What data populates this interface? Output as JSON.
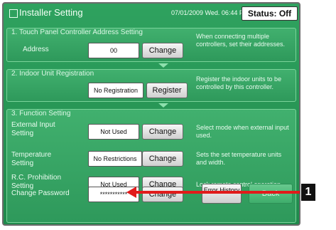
{
  "header": {
    "title": "Installer Setting",
    "datetime": "07/01/2009 Wed. 06:44 PM",
    "status": "Status: Off"
  },
  "sections": {
    "touch_panel": {
      "title": "1. Touch Panel Controller Address Setting",
      "address_label": "Address",
      "address_value": "00",
      "change_label": "Change",
      "description": "When connecting multiple controllers, set their addresses."
    },
    "indoor_unit": {
      "title": "2. Indoor Unit Registration",
      "value": "No Registration",
      "register_label": "Register",
      "description": "Register the indoor units to be controlled by this controller."
    },
    "function": {
      "title": "3. Function Setting",
      "external_input": {
        "label": "External Input Setting",
        "value": "Not Used",
        "button": "Change",
        "description": "Select mode when external input used."
      },
      "temperature": {
        "label": "Temperature Setting",
        "value": "No Restrictions",
        "button": "Change",
        "description": "Sets the set temperature units and width."
      },
      "rc_prohibition": {
        "label": "R.C. Prohibition Setting",
        "value": "Not Used",
        "button": "Change",
        "description": "Lock remote control operation."
      },
      "password": {
        "label": "Change Password",
        "value": "***********",
        "button": "Change"
      }
    }
  },
  "footer": {
    "error_history_label": "Error History",
    "back_label": "Back"
  },
  "callout": {
    "number": "1"
  },
  "colors": {
    "panel_green": "#1f8a4c",
    "section_green": "#41b06e",
    "callout_red": "#e11b1b"
  }
}
